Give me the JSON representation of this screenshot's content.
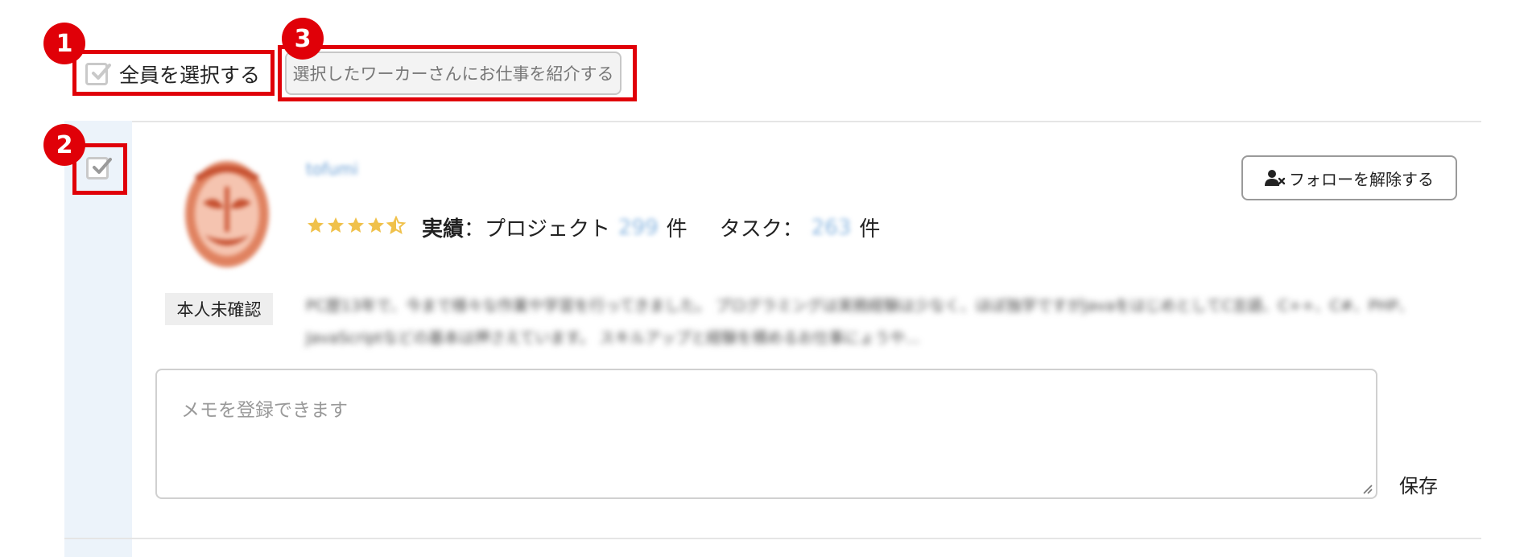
{
  "badges": [
    "1",
    "2",
    "3"
  ],
  "toolbar": {
    "select_all_label": "全員を選択する",
    "introduce_button": "選択したワーカーさんにお仕事を紹介する"
  },
  "worker": {
    "username": "tofumi",
    "verification_status": "本人未確認",
    "rating_stars": 4.5,
    "stats": {
      "label": "実績",
      "project_label": "：プロジェクト",
      "project_count": "299",
      "task_label": "タスク：",
      "task_count": "263",
      "unit": "件"
    },
    "follow_button": "フォローを解除する",
    "bio": "PC歴13年で、今まで様々な作業や学習を行ってきました。 プログラミングは実務経験は少なく、ほぼ独学ですがJavaをはじめとしてC言語、C++、C#、PHP、JavaScriptなどの基本は押さえています。 スキルアップと経験を積めるお仕事にょうや..."
  },
  "memo": {
    "placeholder": "メモを登録できます",
    "save_label": "保存"
  },
  "colors": {
    "annotation_red": "#e00008",
    "row_highlight": "#ecf3fa",
    "star": "#f0c14b"
  }
}
